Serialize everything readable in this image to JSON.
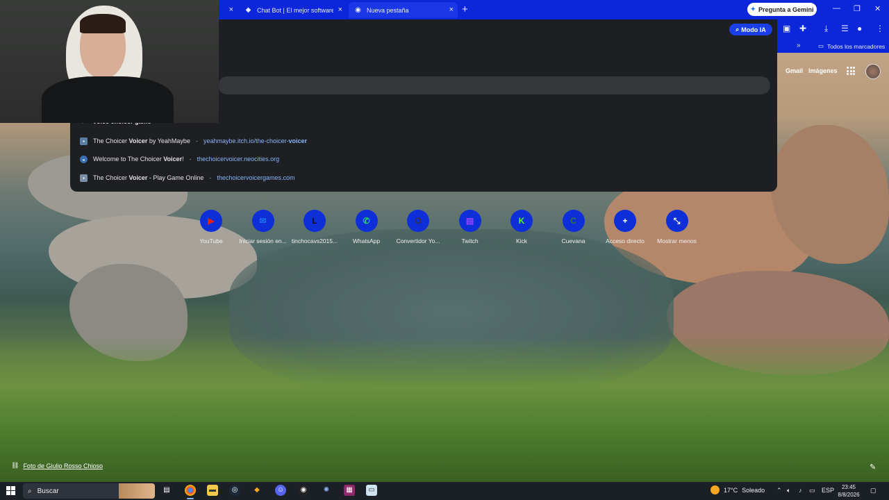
{
  "tabs": [
    {
      "title": "",
      "close": "×"
    },
    {
      "title": "Chat Bot | El mejor software pa",
      "close": "×"
    },
    {
      "title": "Nueva pestaña",
      "close": "×"
    }
  ],
  "new_tab": "+",
  "gemini_button": "Pregunta a Gemini",
  "window_controls": {
    "minimize": "—",
    "maximize": "❐",
    "close": "✕"
  },
  "bookmarks": {
    "overflow": "»",
    "all_label": "Todos los marcadores"
  },
  "omnibox": {
    "modo_ia": "Modo IA",
    "partial_top_suggestion": "voice choicer game",
    "suggestions": [
      {
        "pre": "The Choicer ",
        "bold": "Voicer",
        "post": " by YeahMaybe",
        "sep": "-",
        "url_pre": "yeahmaybe.itch.io/the-choicer-",
        "url_bold": "voicer"
      },
      {
        "pre": "Welcome to The Choicer ",
        "bold": "Voicer",
        "post": "!",
        "sep": "-",
        "url_pre": "thechoicervoicer.neocities.org",
        "url_bold": ""
      },
      {
        "pre": "The Choicer ",
        "bold": "Voicer",
        "post": " - Play Game Online",
        "sep": "-",
        "url_pre": "thechoicervoicergames.com",
        "url_bold": ""
      }
    ]
  },
  "google_links": {
    "gmail": "Gmail",
    "images": "Imágenes"
  },
  "shortcuts": [
    {
      "label": "YouTube",
      "glyph": "▶",
      "color": "#e62117"
    },
    {
      "label": "Iniciar sesión en...",
      "glyph": "✉",
      "color": "#1a73e8"
    },
    {
      "label": "tinchocavs2015...",
      "glyph": "L",
      "color": "#111111"
    },
    {
      "label": "WhatsApp",
      "glyph": "✆",
      "color": "#25d366"
    },
    {
      "label": "Convertidor Yo...",
      "glyph": "O",
      "color": "#333333"
    },
    {
      "label": "Twitch",
      "glyph": "▤",
      "color": "#9146ff"
    },
    {
      "label": "Kick",
      "glyph": "K",
      "color": "#53fc18"
    },
    {
      "label": "Cuevana",
      "glyph": "C",
      "color": "#2e7d32"
    },
    {
      "label": "Acceso directo",
      "glyph": "+",
      "color": "#0e2fd8"
    },
    {
      "label": "Mostrar menos",
      "glyph": "⤡",
      "color": "#0e2fd8"
    }
  ],
  "photo_credit": "Foto de Giulio Rosso Chioso",
  "taskbar": {
    "search_placeholder": "Buscar",
    "weather_temp": "17°C",
    "weather_desc": "Soleado",
    "lang": "ESP",
    "time": "23:45",
    "date": "8/8/2026"
  }
}
